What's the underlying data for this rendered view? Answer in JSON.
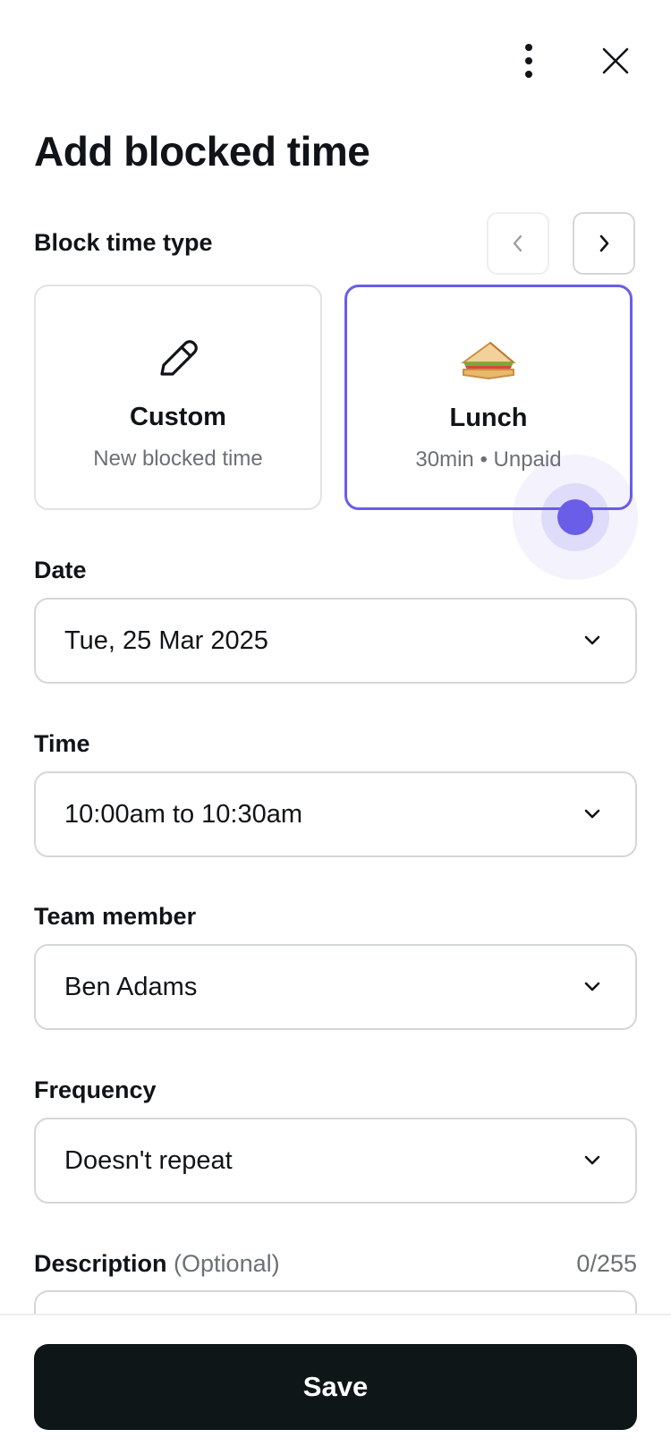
{
  "header": {
    "more_icon": "more-vertical-icon",
    "close_icon": "close-icon",
    "title": "Add blocked time"
  },
  "block_type": {
    "label": "Block time type",
    "prev_icon": "chevron-left-icon",
    "next_icon": "chevron-right-icon",
    "cards": [
      {
        "title": "Custom",
        "subtitle": "New blocked time",
        "icon": "pencil-icon",
        "selected": false
      },
      {
        "title": "Lunch",
        "subtitle": "30min • Unpaid",
        "icon": "sandwich-icon",
        "selected": true
      }
    ]
  },
  "fields": {
    "date": {
      "label": "Date",
      "value": "Tue, 25 Mar 2025"
    },
    "time": {
      "label": "Time",
      "value": "10:00am to 10:30am"
    },
    "team_member": {
      "label": "Team member",
      "value": "Ben Adams"
    },
    "frequency": {
      "label": "Frequency",
      "value": "Doesn't repeat"
    },
    "description": {
      "label": "Description",
      "optional": "(Optional)",
      "count": "0/255",
      "value": ""
    }
  },
  "footer": {
    "save_label": "Save"
  },
  "colors": {
    "accent": "#6a5de8",
    "primary_button": "#0f1618",
    "text": "#101418",
    "muted": "#6b7075"
  }
}
